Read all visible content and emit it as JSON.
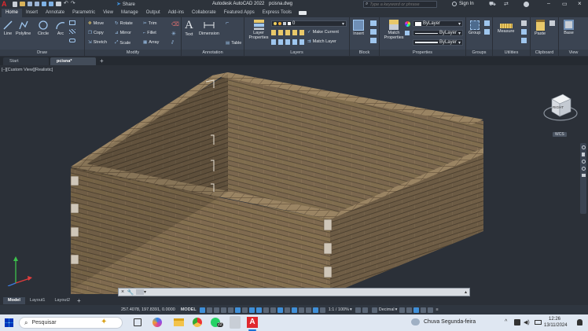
{
  "title_bar": {
    "app_title": "Autodesk AutoCAD 2022",
    "file_name": "pcisna.dwg",
    "search_placeholder": "Type a keyword or phrase",
    "sign_in": "Sign In"
  },
  "ribbon_tabs": [
    "Home",
    "Insert",
    "Annotate",
    "Parametric",
    "View",
    "Manage",
    "Output",
    "Add-ins",
    "Collaborate",
    "Featured Apps",
    "Express Tools"
  ],
  "active_ribbon_tab": "Home",
  "share_label": "Share",
  "panels": {
    "draw": {
      "title": "Draw",
      "line": "Line",
      "polyline": "Polyline",
      "circle": "Circle",
      "arc": "Arc"
    },
    "modify": {
      "title": "Modify",
      "move": "Move",
      "rotate": "Rotate",
      "trim": "Trim",
      "copy": "Copy",
      "mirror": "Mirror",
      "fillet": "Fillet",
      "stretch": "Stretch",
      "scale": "Scale",
      "array": "Array"
    },
    "annotation": {
      "title": "Annotation",
      "text": "Text",
      "dimension": "Dimension",
      "table": "Table"
    },
    "layers": {
      "title": "Layers",
      "layer_properties": "Layer Properties",
      "current_layer": "0",
      "make_current": "Make Current",
      "match_layer": "Match Layer"
    },
    "block": {
      "title": "Block",
      "insert": "Insert"
    },
    "properties": {
      "title": "Properties",
      "match_properties": "Match Properties",
      "color": "ByLayer",
      "linetype": "ByLayer",
      "lineweight": "ByLayer"
    },
    "groups": {
      "title": "Groups",
      "group": "Group"
    },
    "utilities": {
      "title": "Utilities",
      "measure": "Measure"
    },
    "clipboard": {
      "title": "Clipboard",
      "paste": "Paste"
    },
    "view": {
      "title": "View",
      "base": "Base"
    }
  },
  "doc_tabs": [
    "Start",
    "pcisna*"
  ],
  "active_doc_tab": "pcisna*",
  "viewport": {
    "view_label": "[–][Custom View][Realistic]",
    "viewcube_face": "RIGHT",
    "wcs_label": "WCS"
  },
  "command_line": {
    "placeholder": ""
  },
  "layout_tabs": [
    "Model",
    "Layout1",
    "Layout2"
  ],
  "active_layout_tab": "Model",
  "status_bar": {
    "coordinates": "257.4078, 197.8391, 0.0000",
    "model_label": "MODEL",
    "scale": "1:1 / 100%",
    "units": "Decimal"
  },
  "taskbar": {
    "search_placeholder": "Pesquisar",
    "weather": "Chuva Segunda-feira",
    "time": "12:26",
    "date": "13/11/2024",
    "whatsapp_badge": "22"
  },
  "colors": {
    "brick": "#8a7356",
    "brick_dark": "#5e4d38",
    "mortar": "#4a3e2f",
    "viewport_bg": "#2b3038",
    "ribbon_bg": "#3b4452",
    "accent": "#3f8fd8"
  }
}
